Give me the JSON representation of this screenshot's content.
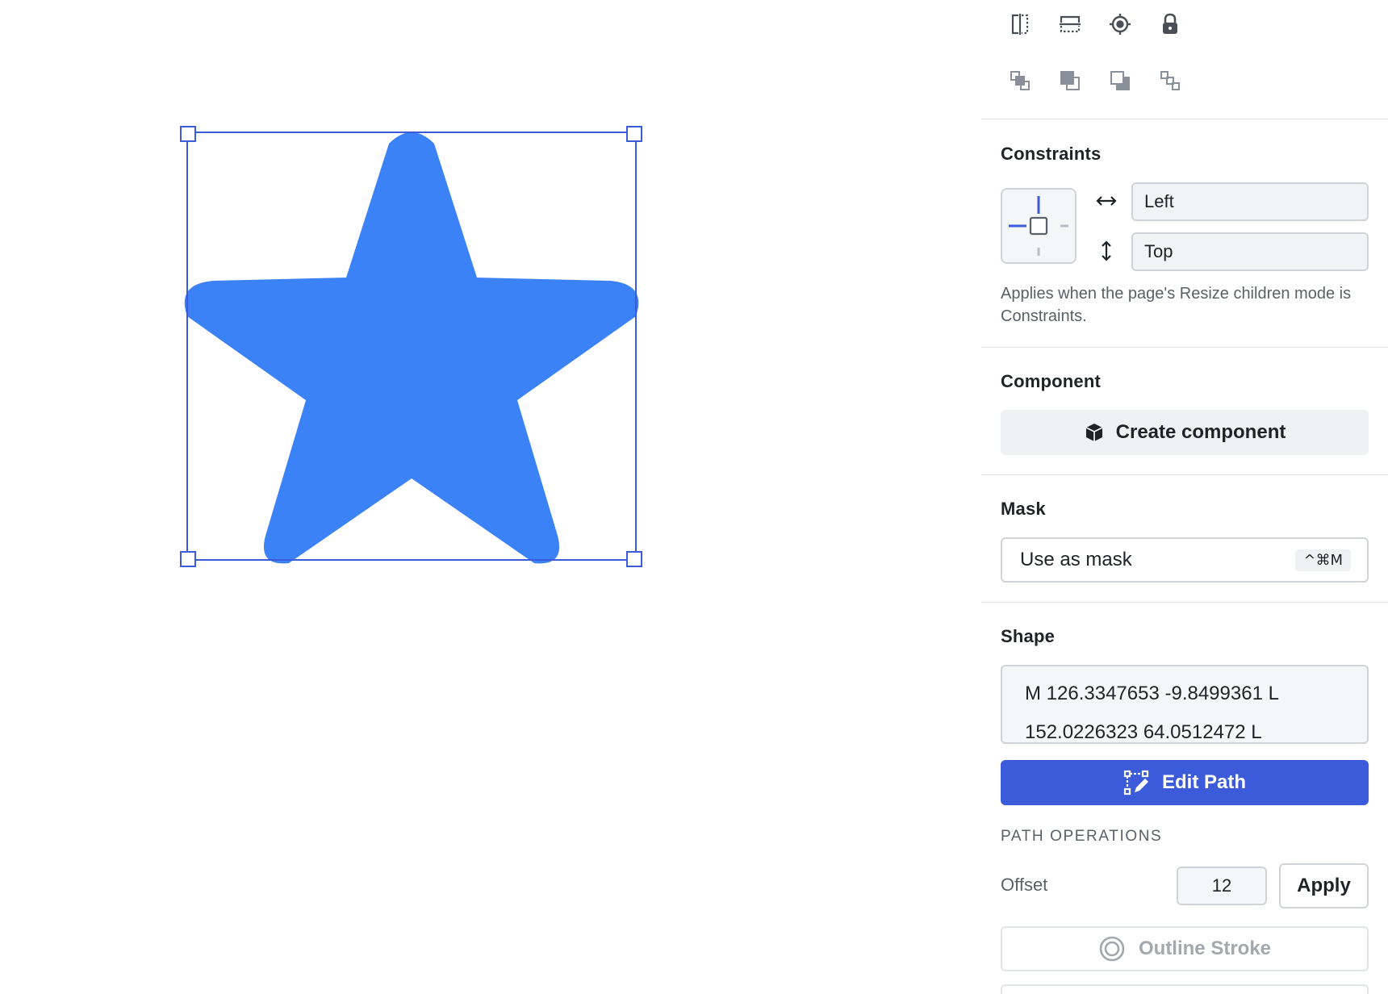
{
  "colors": {
    "star_fill": "#3b82f6",
    "selection": "#3b5bdb",
    "primary_button": "#3b5bdb",
    "anchor_accent": "#3b5bdb"
  },
  "toolbar": {
    "row1": [
      "flip-horizontal-icon",
      "flip-vertical-icon",
      "target-icon",
      "lock-icon"
    ],
    "row2": [
      "bring-forward-icon",
      "bring-to-front-icon",
      "send-to-back-icon",
      "send-backward-icon"
    ]
  },
  "constraints": {
    "title": "Constraints",
    "horizontal": "Left",
    "vertical": "Top",
    "help": "Applies when the page's Resize children mode is Constraints."
  },
  "component": {
    "title": "Component",
    "create_label": "Create component"
  },
  "mask": {
    "title": "Mask",
    "label": "Use as mask",
    "shortcut": "^⌘M"
  },
  "shape": {
    "title": "Shape",
    "path_text": "M 126.3347653 -9.8499361 L 152.0226323 64.0512472 L",
    "edit_label": "Edit Path",
    "path_ops_caption": "PATH OPERATIONS",
    "offset_label": "Offset",
    "offset_value": "12",
    "apply_label": "Apply",
    "outline_label": "Outline Stroke"
  }
}
